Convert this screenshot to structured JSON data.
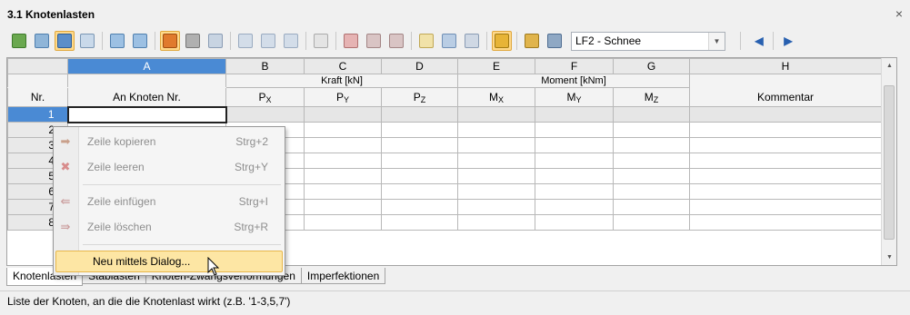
{
  "window": {
    "title": "3.1 Knotenlasten",
    "close_glyph": "×"
  },
  "toolbar": {
    "loadcase_selected": "LF2 - Schnee",
    "icons": [
      "table-icon",
      "table-columns-icon",
      "filter-icon",
      "grid-icon",
      "import-icon",
      "export-icon",
      "select-icon",
      "pointer-icon",
      "view-icon",
      "zoom-icon",
      "copy-icon",
      "settings-icon",
      "delete-row-icon",
      "clear-row-icon",
      "insert-row-icon",
      "remove-row-icon",
      "table-view-icon",
      "table-toggle-icon",
      "edit-icon",
      "color-icon",
      "node-icon",
      "graphics-icon"
    ],
    "prev_glyph": "◀",
    "next_glyph": "▶",
    "dropdown_glyph": "▼"
  },
  "grid": {
    "col_letters": [
      "A",
      "B",
      "C",
      "D",
      "E",
      "F",
      "G",
      "H"
    ],
    "group_headers": {
      "kraft": "Kraft [kN]",
      "moment": "Moment [kNm]"
    },
    "headers": {
      "nr": "Nr.",
      "a": "An Knoten Nr.",
      "b": "P",
      "b_sub": "X",
      "c": "P",
      "c_sub": "Y",
      "d": "P",
      "d_sub": "Z",
      "e": "M",
      "e_sub": "X",
      "f": "M",
      "f_sub": "Y",
      "g": "M",
      "g_sub": "Z",
      "h": "Kommentar"
    },
    "row_numbers": [
      "1",
      "2",
      "3",
      "4",
      "5",
      "6",
      "7",
      "8"
    ]
  },
  "context_menu": {
    "items": [
      {
        "label": "Zeile kopieren",
        "shortcut": "Strg+2",
        "icon": "copy-row-icon"
      },
      {
        "label": "Zeile leeren",
        "shortcut": "Strg+Y",
        "icon": "clear-row-icon"
      },
      {
        "label": "Zeile einfügen",
        "shortcut": "Strg+I",
        "icon": "insert-row-icon"
      },
      {
        "label": "Zeile löschen",
        "shortcut": "Strg+R",
        "icon": "delete-row-icon"
      }
    ],
    "highlighted": "Neu mittels Dialog..."
  },
  "tabs": [
    "Knotenlasten",
    "Stablasten",
    "Knoten-Zwangsverformungen",
    "Imperfektionen"
  ],
  "status_text": "Liste der Knoten, an die die Knotenlast wirkt (z.B. '1-3,5,7')",
  "colors": {
    "selection": "#4a8ad4",
    "highlight": "#fde6a4",
    "toggle_active": "#ffd98a"
  }
}
